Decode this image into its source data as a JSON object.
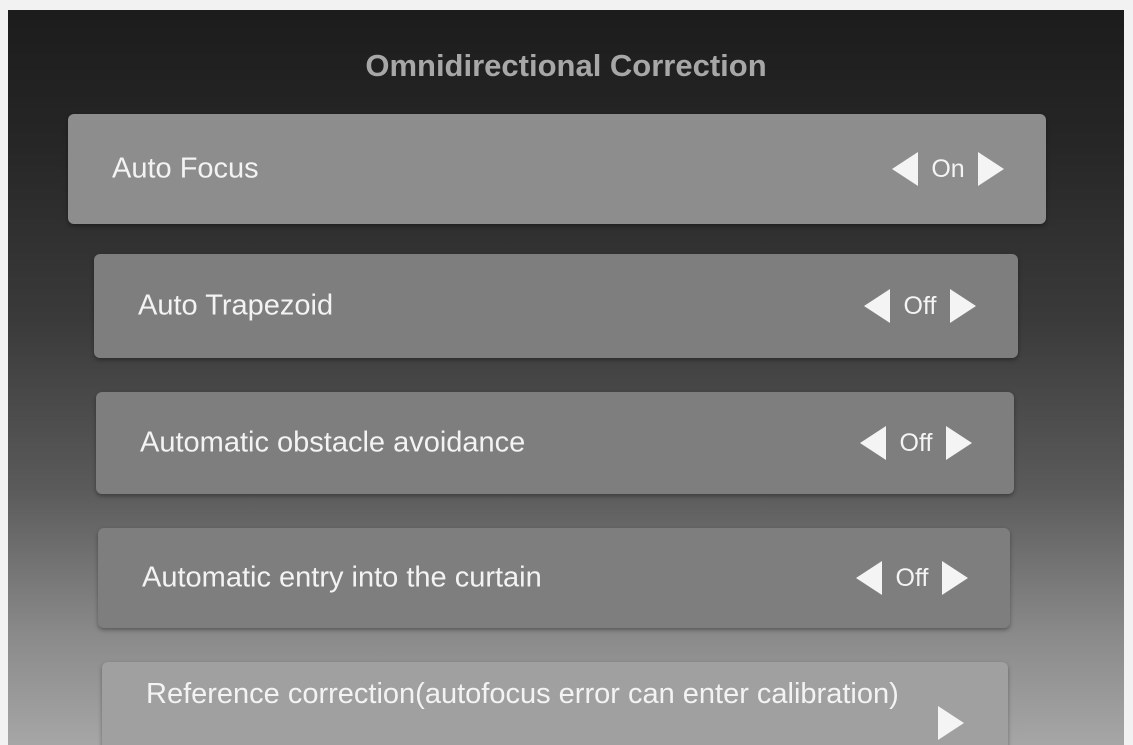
{
  "header": {
    "title": "Omnidirectional Correction"
  },
  "settings": [
    {
      "label": "Auto Focus",
      "value": "On"
    },
    {
      "label": "Auto Trapezoid",
      "value": "Off"
    },
    {
      "label": "Automatic obstacle avoidance",
      "value": "Off"
    },
    {
      "label": "Automatic entry into the curtain",
      "value": "Off"
    },
    {
      "label": "Reference correction(autofocus error can enter calibration)"
    }
  ],
  "icons": {
    "prev": "triangle-left-icon",
    "next": "triangle-right-icon"
  },
  "colors": {
    "row_background": "#7e7e7e",
    "focused_row_background": "#8d8d8d",
    "text": "#f3f3f3",
    "title": "#a7a7a7"
  }
}
